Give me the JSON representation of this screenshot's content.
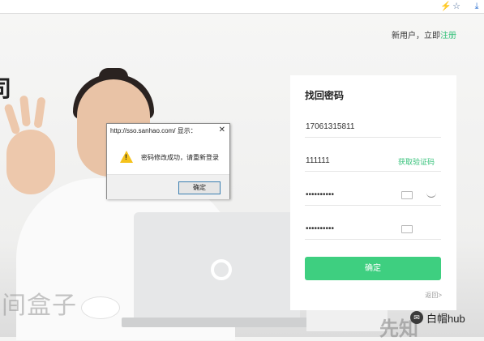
{
  "browser": {
    "icons": [
      "bolt-icon",
      "star-icon",
      "download-icon"
    ],
    "bolt_glyph": "⚡",
    "star_glyph": "☆",
    "download_glyph": "⤓"
  },
  "header": {
    "prompt": "新用户，立即",
    "register_link": "注册"
  },
  "background": {
    "left_char": "司",
    "watermark_left": "间盒子",
    "watermark_right": "先知",
    "brand_icon": "✉",
    "brand_name": "白帽hub"
  },
  "form": {
    "title": "找回密码",
    "phone_value": "17061315811",
    "code_value": "111111",
    "get_code_label": "获取验证码",
    "password_value": "••••••••••",
    "confirm_password_value": "••••••••••",
    "submit_label": "确定",
    "back_label": "返回>"
  },
  "dialog": {
    "title": "http://sso.sanhao.com/ 显示：",
    "close_glyph": "✕",
    "warning_mark": "!",
    "message": "密码修改成功，请重新登录",
    "ok_label": "确定"
  },
  "colors": {
    "accent": "#3ecf80",
    "link": "#37c27b"
  }
}
